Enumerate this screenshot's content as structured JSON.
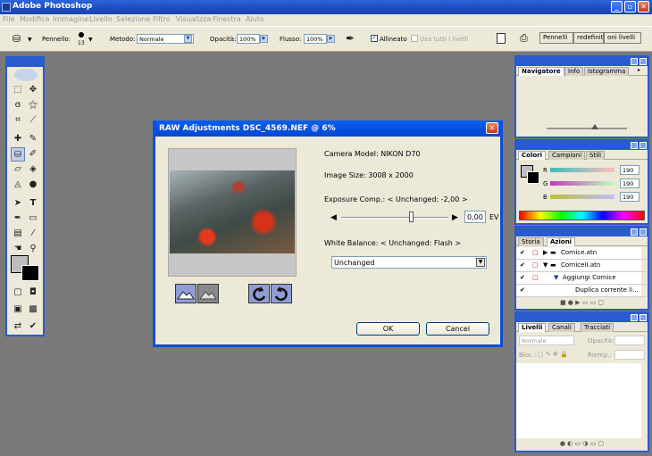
{
  "app": {
    "title": "Adobe Photoshop"
  },
  "menu": [
    "File",
    "Modifica",
    "Immagine",
    "Livello",
    "Selezione",
    "Filtro",
    "Visualizza",
    "Finestra",
    "Aiuto"
  ],
  "options": {
    "brush_label": "Pennello:",
    "brush_size": "13",
    "mode_label": "Metodo:",
    "mode_value": "Normale",
    "opacity_label": "Opacità:",
    "opacity_value": "100%",
    "flow_label": "Flusso:",
    "flow_value": "100%",
    "aligned_label": "Allineato",
    "use_all_layers_label": "Usa tutti i livelli",
    "well_tabs": [
      "Pennelli",
      "redefiniti",
      "oni livelli"
    ]
  },
  "dialog": {
    "title": "RAW Adjustments DSC_4569.NEF @ 6%",
    "camera_model": "Camera Model: NIKON D70",
    "image_size": "Image Size: 3008 x 2000",
    "exposure_label": "Exposure Comp.: < Unchanged: -2,00 >",
    "exposure_value": "0,00",
    "exposure_unit": "EV",
    "exposure_level": 0.65,
    "wb_label": "White Balance: < Unchanged: Flash >",
    "wb_value": "Unchanged",
    "ok_label": "OK",
    "cancel_label": "Cancel"
  },
  "navigator": {
    "tabs": [
      "Navigatore",
      "Info",
      "Istogramma"
    ]
  },
  "colors": {
    "tabs": [
      "Colori",
      "Campioni",
      "Stili"
    ],
    "r_label": "R",
    "g_label": "G",
    "b_label": "B",
    "r_value": "190",
    "g_value": "190",
    "b_value": "190",
    "swatch": "#bebebe"
  },
  "actions": {
    "tabs": [
      "Storia",
      "Azioni"
    ],
    "items": [
      "Cornice.atn",
      "CorniceII.atn",
      "Aggiungi Cornice",
      "Duplica corrente li..."
    ]
  },
  "layers": {
    "tabs": [
      "Livelli",
      "Canali",
      "Tracciati"
    ],
    "blend": "Normale",
    "opacity_label": "Opacità:",
    "lock_label": "Bloc.:",
    "fill_label": "Riemp.:"
  }
}
